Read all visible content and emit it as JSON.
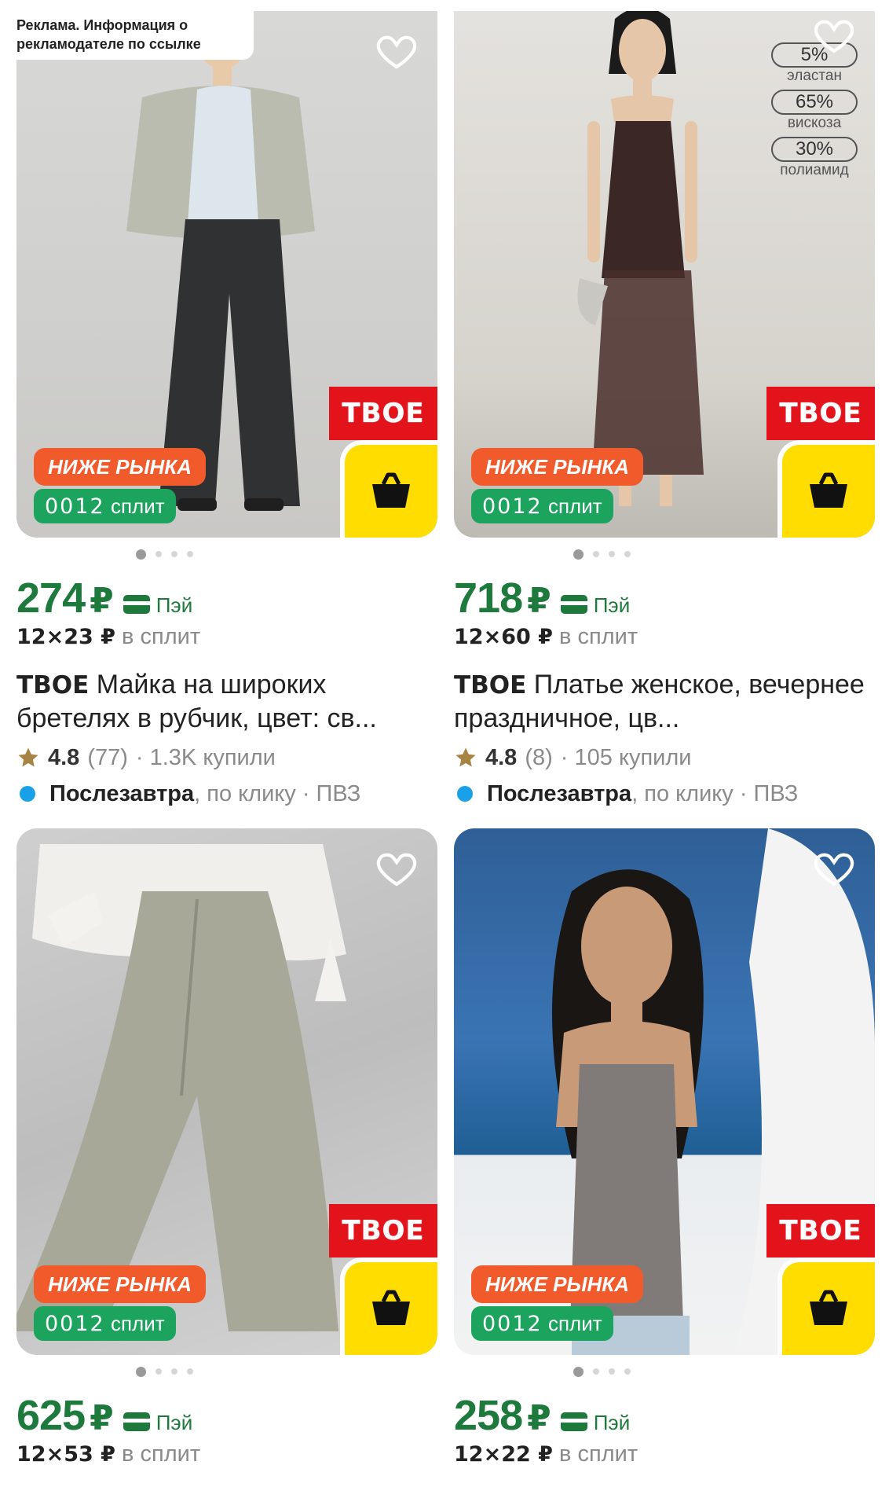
{
  "ad_label": "Реклама. Информация о рекламодателе по ссылке",
  "products": [
    {
      "brand_tag": "ТВОЕ",
      "badge_below": "НИЖЕ РЫНКА",
      "split_badge_num": "0012",
      "split_badge_text": "сплит",
      "price": "274",
      "currency": "₽",
      "pay_label": "Пэй",
      "split_value": "12×23 ₽",
      "split_text": "в сплит",
      "brand": "ТВОЕ",
      "title": "Майка на широких бретелях в рубчик, цвет: св...",
      "rating": "4.8",
      "reviews": "(77)",
      "bought": "· 1.3K купили",
      "delivery_when": "Послезавтра",
      "delivery_rest": ", по клику · ПВЗ"
    },
    {
      "brand_tag": "ТВОЕ",
      "badge_below": "НИЖЕ РЫНКА",
      "split_badge_num": "0012",
      "split_badge_text": "сплит",
      "price": "718",
      "currency": "₽",
      "pay_label": "Пэй",
      "split_value": "12×60 ₽",
      "split_text": "в сплит",
      "brand": "ТВОЕ",
      "title": "Платье женское, вечернее праздничное, цв...",
      "rating": "4.8",
      "reviews": "(8)",
      "bought": "· 105 купили",
      "delivery_when": "Послезавтра",
      "delivery_rest": ", по клику · ПВЗ",
      "composition": [
        {
          "pct": "5%",
          "name": "эластан"
        },
        {
          "pct": "65%",
          "name": "вискоза"
        },
        {
          "pct": "30%",
          "name": "полиамид"
        }
      ]
    },
    {
      "brand_tag": "ТВОЕ",
      "badge_below": "НИЖЕ РЫНКА",
      "split_badge_num": "0012",
      "split_badge_text": "сплит",
      "price": "625",
      "currency": "₽",
      "pay_label": "Пэй",
      "split_value": "12×53 ₽",
      "split_text": "в сплит"
    },
    {
      "brand_tag": "ТВОЕ",
      "badge_below": "НИЖЕ РЫНКА",
      "split_badge_num": "0012",
      "split_badge_text": "сплит",
      "price": "258",
      "currency": "₽",
      "pay_label": "Пэй",
      "split_value": "12×22 ₽",
      "split_text": "в сплит"
    }
  ],
  "colors": {
    "price_green": "#1d7a3c",
    "badge_orange": "#f15a2b",
    "split_green": "#1ca35e",
    "brand_red": "#e3131b",
    "cart_yellow": "#ffdd00",
    "delivery_blue": "#1aa0e8",
    "star": "#a88444"
  },
  "icons": [
    "heart-icon",
    "cart-basket-icon",
    "pay-card-icon",
    "star-icon",
    "delivery-dot"
  ]
}
